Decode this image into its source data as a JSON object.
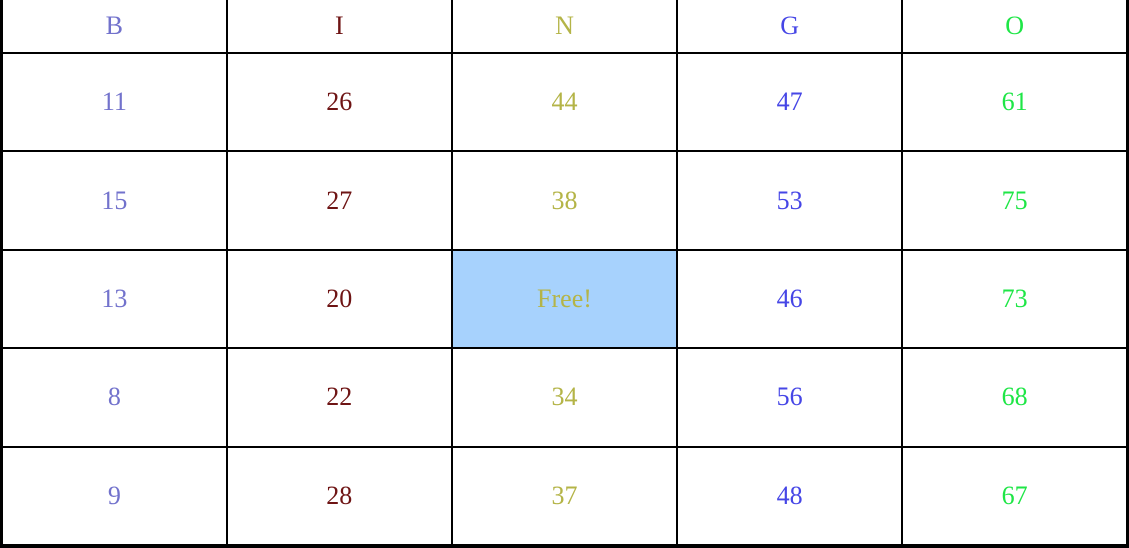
{
  "card": {
    "columns": [
      {
        "letter": "B",
        "color": "#7272cc"
      },
      {
        "letter": "I",
        "color": "#6e1414"
      },
      {
        "letter": "N",
        "color": "#b4b447"
      },
      {
        "letter": "G",
        "color": "#4646e6"
      },
      {
        "letter": "O",
        "color": "#1ee646"
      }
    ],
    "rows": [
      [
        "11",
        "26",
        "44",
        "47",
        "61"
      ],
      [
        "15",
        "27",
        "38",
        "53",
        "75"
      ],
      [
        "13",
        "20",
        "Free!",
        "46",
        "73"
      ],
      [
        "8",
        "22",
        "34",
        "56",
        "68"
      ],
      [
        "9",
        "28",
        "37",
        "48",
        "67"
      ]
    ],
    "free_cell": {
      "row": 2,
      "col": 2,
      "highlight_color": "#a7d2fd"
    }
  }
}
